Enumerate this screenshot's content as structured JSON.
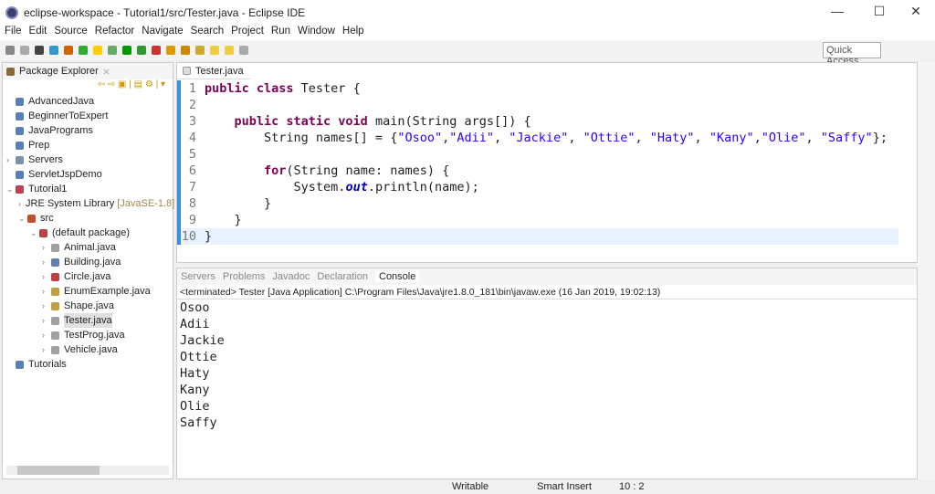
{
  "window": {
    "title": "eclipse-workspace - Tutorial1/src/Tester.java - Eclipse IDE",
    "minimize": "—",
    "maximize": "☐",
    "close": "✕"
  },
  "menu": [
    "File",
    "Edit",
    "Source",
    "Refactor",
    "Navigate",
    "Search",
    "Project",
    "Run",
    "Window",
    "Help"
  ],
  "quick_access": "Quick Access",
  "explorer": {
    "title": "Package Explorer",
    "items": [
      {
        "label": "AdvancedJava",
        "depth": 0,
        "arrow": "",
        "color": "#5a7fb8"
      },
      {
        "label": "BeginnerToExpert",
        "depth": 0,
        "arrow": "",
        "color": "#5a7fb8"
      },
      {
        "label": "JavaPrograms",
        "depth": 0,
        "arrow": "",
        "color": "#5a7fb8"
      },
      {
        "label": "Prep",
        "depth": 0,
        "arrow": "",
        "color": "#5a7fb8"
      },
      {
        "label": "Servers",
        "depth": 0,
        "arrow": ">",
        "color": "#7a8fa8"
      },
      {
        "label": "ServletJspDemo",
        "depth": 0,
        "arrow": "",
        "color": "#5a7fb8"
      },
      {
        "label": "Tutorial1",
        "depth": 0,
        "arrow": "v",
        "color": "#c04050"
      },
      {
        "label": "JRE System Library",
        "extra": "[JavaSE-1.8]",
        "depth": 1,
        "arrow": ">",
        "color": "#a08040"
      },
      {
        "label": "src",
        "depth": 1,
        "arrow": "v",
        "color": "#c05030"
      },
      {
        "label": "(default package)",
        "depth": 2,
        "arrow": "v",
        "color": "#c04040"
      },
      {
        "label": "Animal.java",
        "depth": 3,
        "arrow": ">",
        "color": "#a0a0a0"
      },
      {
        "label": "Building.java",
        "depth": 3,
        "arrow": ">",
        "color": "#6080b0"
      },
      {
        "label": "Circle.java",
        "depth": 3,
        "arrow": ">",
        "color": "#c04040"
      },
      {
        "label": "EnumExample.java",
        "depth": 3,
        "arrow": ">",
        "color": "#c0a040"
      },
      {
        "label": "Shape.java",
        "depth": 3,
        "arrow": ">",
        "color": "#c0a040"
      },
      {
        "label": "Tester.java",
        "depth": 3,
        "arrow": ">",
        "color": "#a0a0a0",
        "selected": true
      },
      {
        "label": "TestProg.java",
        "depth": 3,
        "arrow": ">",
        "color": "#a0a0a0"
      },
      {
        "label": "Vehicle.java",
        "depth": 3,
        "arrow": ">",
        "color": "#a0a0a0"
      },
      {
        "label": "Tutorials",
        "depth": 0,
        "arrow": "",
        "color": "#5a7fb8"
      }
    ]
  },
  "editor": {
    "tab": "Tester.java",
    "lines": [
      [
        [
          "kw",
          "public class "
        ],
        [
          "",
          "Tester {"
        ]
      ],
      [],
      [
        [
          "",
          "    "
        ],
        [
          "kw",
          "public static void "
        ],
        [
          "",
          "main(String args[]) {"
        ]
      ],
      [
        [
          "",
          "        String names[] = {"
        ],
        [
          "str",
          "\"Osoo\""
        ],
        [
          "",
          ","
        ],
        [
          "str",
          "\"Adii\""
        ],
        [
          "",
          ", "
        ],
        [
          "str",
          "\"Jackie\""
        ],
        [
          "",
          ", "
        ],
        [
          "str",
          "\"Ottie\""
        ],
        [
          "",
          ", "
        ],
        [
          "str",
          "\"Haty\""
        ],
        [
          "",
          ", "
        ],
        [
          "str",
          "\"Kany\""
        ],
        [
          "",
          ","
        ],
        [
          "str",
          "\"Olie\""
        ],
        [
          "",
          ", "
        ],
        [
          "str",
          "\"Saffy\""
        ],
        [
          "",
          "};"
        ]
      ],
      [],
      [
        [
          "",
          "        "
        ],
        [
          "kw",
          "for"
        ],
        [
          "",
          "(String name: names) {"
        ]
      ],
      [
        [
          "",
          "            System."
        ],
        [
          "fld",
          "out"
        ],
        [
          "",
          ".println(name);"
        ]
      ],
      [
        [
          "",
          "        }"
        ]
      ],
      [
        [
          "",
          "    }"
        ]
      ],
      [
        [
          "",
          "}"
        ]
      ]
    ]
  },
  "console": {
    "tabs": [
      "Servers",
      "Problems",
      "Javadoc",
      "Declaration",
      "Console"
    ],
    "active": "Console",
    "header": "<terminated> Tester [Java Application] C:\\Program Files\\Java\\jre1.8.0_181\\bin\\javaw.exe (16 Jan 2019, 19:02:13)",
    "output": [
      "Osoo",
      "Adii",
      "Jackie",
      "Ottie",
      "Haty",
      "Kany",
      "Olie",
      "Saffy"
    ]
  },
  "status": {
    "writable": "Writable",
    "insert": "Smart Insert",
    "position": "10 : 2"
  }
}
